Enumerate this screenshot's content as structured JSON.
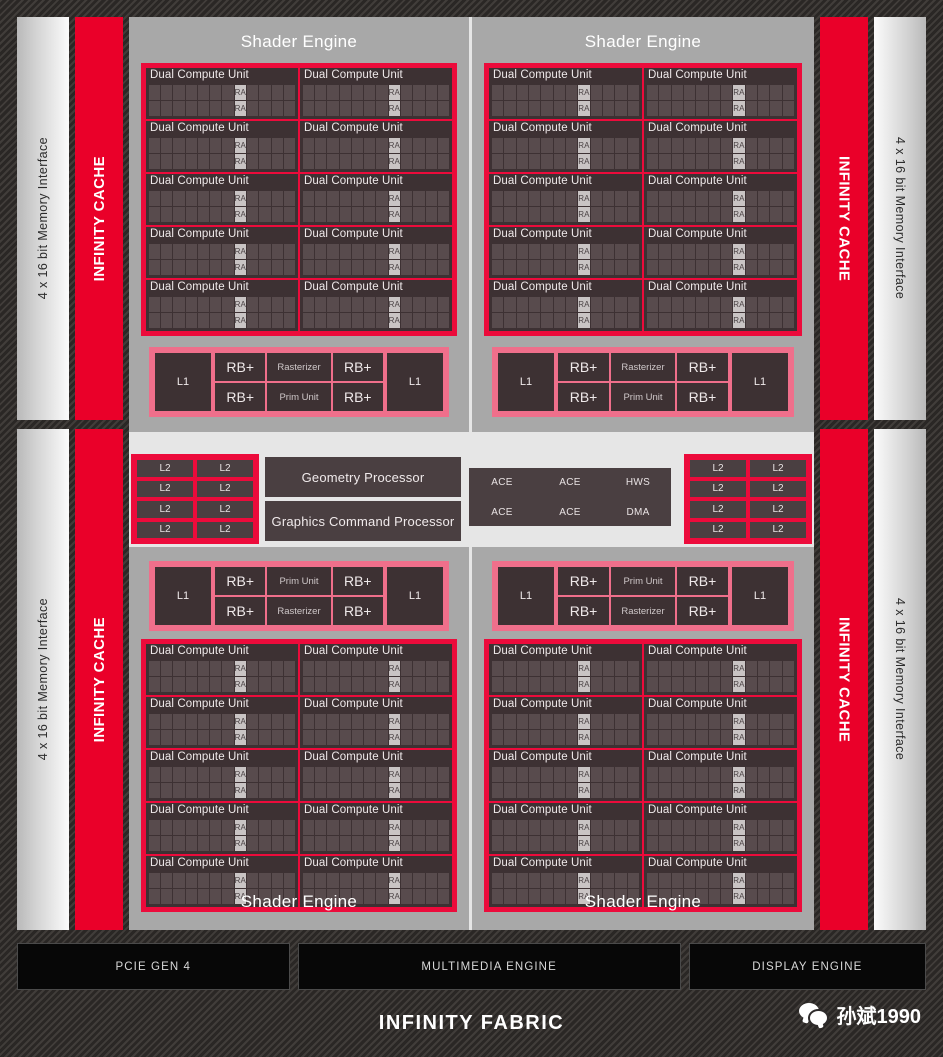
{
  "diagram": {
    "title": "AMD RDNA 2 GPU Block Diagram",
    "colors": {
      "accent_red": "#ec0b3b",
      "infinity_cache_red": "#ea0029",
      "panel_gray": "#e6e6e6",
      "shader_engine_gray": "#a8a8a8",
      "block_dark": "#3d3133",
      "background_dark": "#36322f"
    }
  },
  "memory_interface": {
    "label": "4 x 16 bit Memory Interface",
    "count": 4
  },
  "infinity_cache": {
    "label": "INFINITY CACHE",
    "count": 4
  },
  "shader_engines": [
    {
      "position": "top-left",
      "label": "Shader Engine",
      "title_position": "top"
    },
    {
      "position": "top-right",
      "label": "Shader Engine",
      "title_position": "top"
    },
    {
      "position": "bottom-left",
      "label": "Shader Engine",
      "title_position": "bottom"
    },
    {
      "position": "bottom-right",
      "label": "Shader Engine",
      "title_position": "bottom"
    }
  ],
  "dual_compute_unit": {
    "label": "Dual Compute Unit",
    "ra_label": "RA",
    "ra_per_unit": 2,
    "rows_per_engine": 5,
    "columns_per_engine": 2,
    "units_per_engine": 10,
    "total_units": 40
  },
  "rb_strip": {
    "l1_label": "L1",
    "rb_label": "RB+",
    "rasterizer_label": "Rasterizer",
    "prim_unit_label": "Prim Unit",
    "rb_per_strip": 4,
    "top_engines_order": [
      "RB+",
      "Rasterizer",
      "RB+",
      "RB+",
      "Prim Unit",
      "RB+"
    ],
    "bottom_engines_order": [
      "RB+",
      "Prim Unit",
      "RB+",
      "RB+",
      "Rasterizer",
      "RB+"
    ]
  },
  "l2_cache": {
    "label": "L2",
    "blocks_per_group": 8,
    "groups": 2,
    "grid": "2 x 4"
  },
  "command_processors": {
    "geometry_processor": "Geometry Processor",
    "graphics_command_processor": "Graphics Command Processor"
  },
  "ace_block": {
    "row1": [
      "ACE",
      "ACE",
      "HWS"
    ],
    "row2": [
      "ACE",
      "ACE",
      "DMA"
    ]
  },
  "bottom_engines": [
    {
      "label": "PCIE GEN 4",
      "flex": 1.15
    },
    {
      "label": "MULTIMEDIA ENGINE",
      "flex": 1.62
    },
    {
      "label": "DISPLAY ENGINE",
      "flex": 1.0
    }
  ],
  "infinity_fabric": {
    "label": "INFINITY FABRIC"
  },
  "watermark": {
    "label": "孙斌1990",
    "icon": "wechat-icon"
  }
}
